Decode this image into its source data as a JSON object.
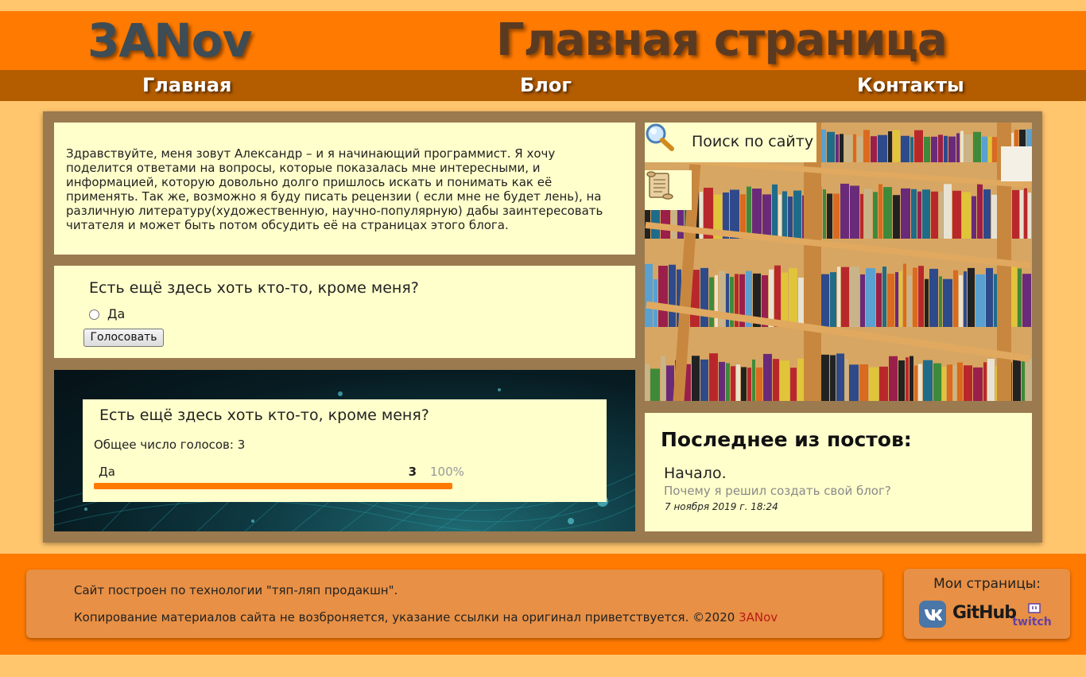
{
  "header": {
    "logo": "3ANov",
    "page_title": "Главная страница"
  },
  "nav": {
    "items": [
      {
        "label": "Главная"
      },
      {
        "label": "Блог"
      },
      {
        "label": "Контакты"
      }
    ]
  },
  "intro": {
    "text": "Здравствуйте, меня зовут Александр – и я начинающий программист. Я хочу поделится ответами на вопросы, которые показалась мне интересными, и информацией, которую довольно долго пришлось искать и понимать как её применять. Так же, возможно я буду писать рецензии ( если мне не будет лень), на различную литературу(художественную, научно-популярную) дабы заинтересовать читателя и может быть потом обсудить её на страницах этого блога."
  },
  "poll": {
    "question": "Есть ещё здесь хоть кто-то, кроме меня?",
    "option": "Да",
    "vote_button": "Голосовать"
  },
  "results": {
    "question": "Есть ещё здесь хоть кто-то, кроме меня?",
    "total_label": "Общее число голосов: 3",
    "options": [
      {
        "label": "Да",
        "count": "3",
        "percent_label": "100%",
        "fraction": 1.0
      }
    ]
  },
  "search": {
    "label": "Поиск по сайту",
    "icon": "magnifier-icon"
  },
  "archive": {
    "icon": "scroll-icon"
  },
  "posts": {
    "heading": "Последнее из постов:",
    "items": [
      {
        "title": "Начало.",
        "subtitle": "Почему я решил создать свой блог?",
        "date": "7 ноября 2019 г. 18:24"
      }
    ]
  },
  "footer": {
    "line1": "Сайт построен по технологии \"тяп-ляп продакшн\".",
    "line2": "Копирование материалов сайта не возброняется, указание ссылки на оригинал приветствуется. ©2020",
    "link": "3ANov",
    "my_pages": "Мои страницы:",
    "github": "GitHub",
    "twitch": "twitch"
  },
  "colors": {
    "background": "#ffc66e",
    "header": "#ff7a00",
    "nav": "#b35c00",
    "panel": "#ffffcc",
    "accent": "#ff7a00",
    "link": "#b81b16"
  }
}
